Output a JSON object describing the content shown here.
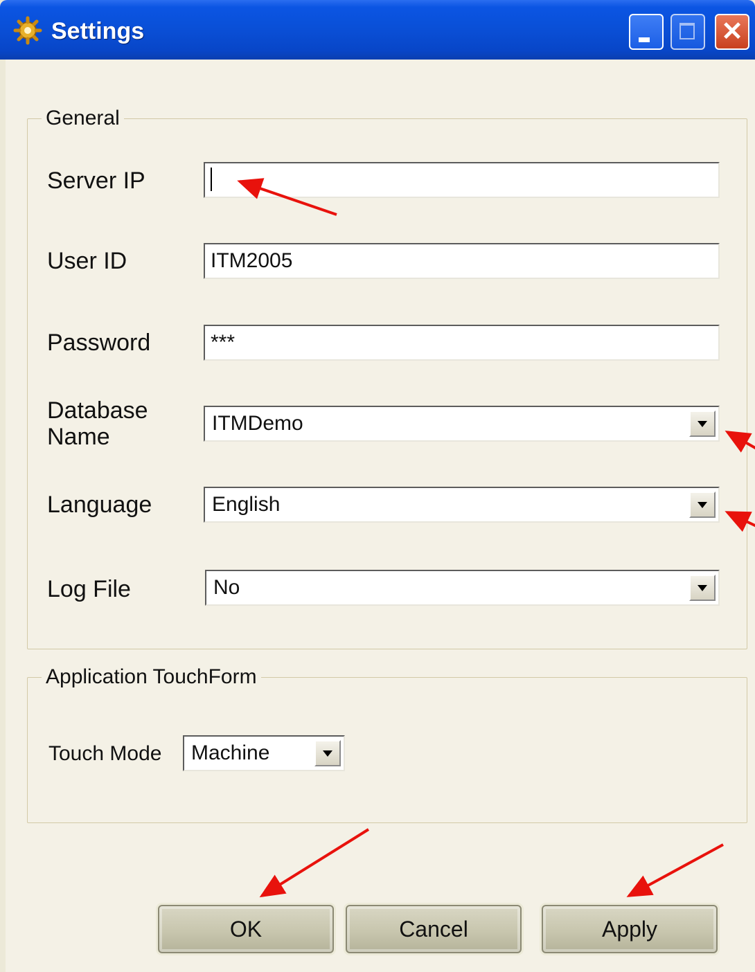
{
  "window": {
    "title": "Settings",
    "icon": "app-gear-icon",
    "controls": [
      "minimize-icon",
      "maximize-icon",
      "close-icon"
    ],
    "close_glyph": "✕"
  },
  "general": {
    "legend": "General",
    "server_ip": {
      "label": "Server IP",
      "value": ""
    },
    "user_id": {
      "label": "User ID",
      "value": "ITM2005"
    },
    "password": {
      "label": "Password",
      "value": "***"
    },
    "database_name": {
      "label": "Database Name",
      "line1": "Database",
      "line2": "Name",
      "value": "ITMDemo"
    },
    "language": {
      "label": "Language",
      "value": "English"
    },
    "log_file": {
      "label": "Log File",
      "value": "No"
    }
  },
  "touchform": {
    "legend": "Application TouchForm",
    "touch_mode": {
      "label": "Touch Mode",
      "value": "Machine"
    }
  },
  "buttons": {
    "ok": "OK",
    "cancel": "Cancel",
    "apply": "Apply"
  },
  "annotation_color": "#e8120c"
}
